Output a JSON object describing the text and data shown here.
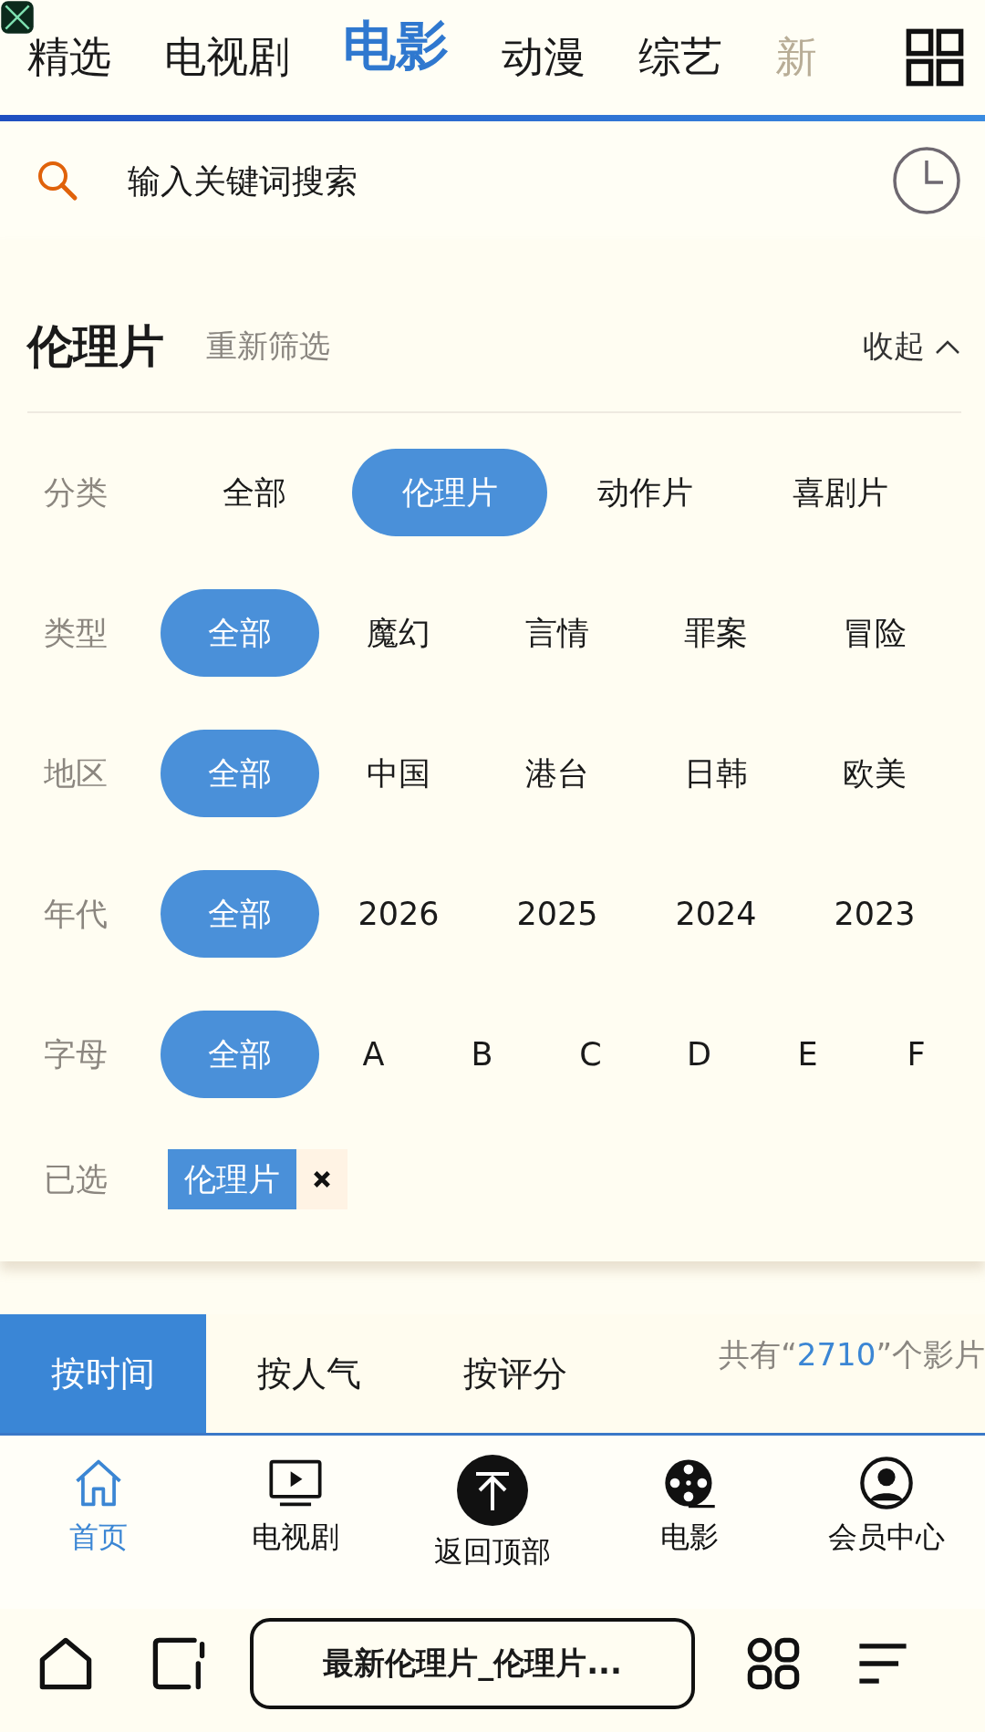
{
  "top_tabs": [
    {
      "label": "精选",
      "selected": false,
      "faded": false
    },
    {
      "label": "电视剧",
      "selected": false,
      "faded": false
    },
    {
      "label": "电影",
      "selected": true,
      "faded": false
    },
    {
      "label": "动漫",
      "selected": false,
      "faded": false
    },
    {
      "label": "综艺",
      "selected": false,
      "faded": false
    },
    {
      "label": "新",
      "selected": false,
      "faded": true
    }
  ],
  "search": {
    "placeholder": "输入关键词搜索"
  },
  "filter": {
    "title": "伦理片",
    "reset": "重新筛选",
    "collapse": "收起",
    "rows": [
      {
        "label": "分类",
        "kind": "wide",
        "options": [
          {
            "label": "全部",
            "selected": false
          },
          {
            "label": "伦理片",
            "selected": true
          },
          {
            "label": "动作片",
            "selected": false
          },
          {
            "label": "喜剧片",
            "selected": false
          }
        ]
      },
      {
        "label": "类型",
        "kind": "normal",
        "options": [
          {
            "label": "全部",
            "selected": true
          },
          {
            "label": "魔幻",
            "selected": false
          },
          {
            "label": "言情",
            "selected": false
          },
          {
            "label": "罪案",
            "selected": false
          },
          {
            "label": "冒险",
            "selected": false
          }
        ]
      },
      {
        "label": "地区",
        "kind": "normal",
        "options": [
          {
            "label": "全部",
            "selected": true
          },
          {
            "label": "中国",
            "selected": false
          },
          {
            "label": "港台",
            "selected": false
          },
          {
            "label": "日韩",
            "selected": false
          },
          {
            "label": "欧美",
            "selected": false
          }
        ]
      },
      {
        "label": "年代",
        "kind": "normal",
        "options": [
          {
            "label": "全部",
            "selected": true
          },
          {
            "label": "2026",
            "selected": false
          },
          {
            "label": "2025",
            "selected": false
          },
          {
            "label": "2024",
            "selected": false
          },
          {
            "label": "2023",
            "selected": false
          }
        ]
      },
      {
        "label": "字母",
        "kind": "narrow",
        "options": [
          {
            "label": "全部",
            "selected": true
          },
          {
            "label": "A",
            "selected": false
          },
          {
            "label": "B",
            "selected": false
          },
          {
            "label": "C",
            "selected": false
          },
          {
            "label": "D",
            "selected": false
          },
          {
            "label": "E",
            "selected": false
          },
          {
            "label": "F",
            "selected": false
          }
        ]
      }
    ],
    "chosen_label": "已选",
    "chosen": [
      "伦理片"
    ]
  },
  "sort_tabs": [
    {
      "label": "按时间",
      "selected": true
    },
    {
      "label": "按人气",
      "selected": false
    },
    {
      "label": "按评分",
      "selected": false
    }
  ],
  "count": {
    "prefix": "共有“",
    "value": "2710",
    "suffix": "”个影片"
  },
  "bottom_nav": [
    {
      "label": "首页",
      "kind": "home",
      "selected": true
    },
    {
      "label": "电视剧",
      "kind": "tv",
      "selected": false
    },
    {
      "label": "返回顶部",
      "kind": "top",
      "selected": false
    },
    {
      "label": "电影",
      "kind": "reel",
      "selected": false
    },
    {
      "label": "会员中心",
      "kind": "user",
      "selected": false
    }
  ],
  "browser": {
    "title": "最新伦理片_伦理片..."
  }
}
